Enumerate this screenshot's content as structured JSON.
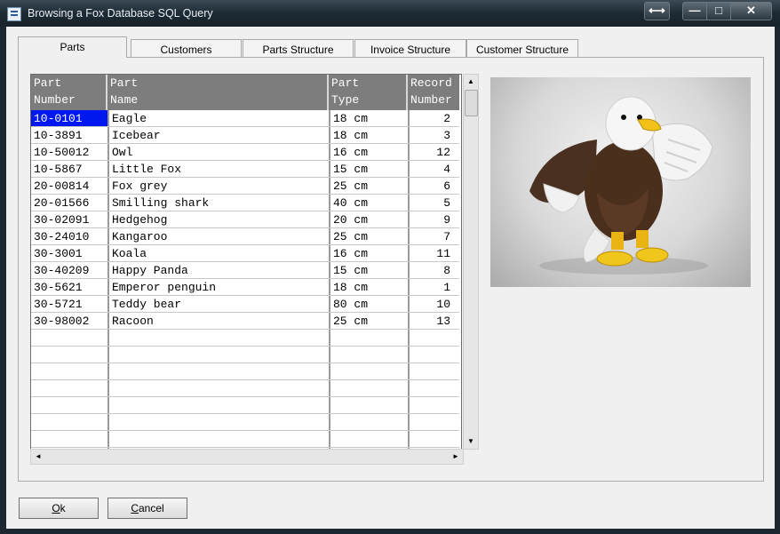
{
  "window": {
    "title": "Browsing a Fox Database SQL Query",
    "buttons": {
      "resize": "⟷",
      "minimize": "—",
      "maximize": "□",
      "close": "✕"
    }
  },
  "tabs": [
    {
      "label": "Parts",
      "active": true
    },
    {
      "label": "Customers",
      "active": false
    },
    {
      "label": "Parts Structure",
      "active": false
    },
    {
      "label": "Invoice Structure",
      "active": false
    },
    {
      "label": "Customer Structure",
      "active": false
    }
  ],
  "grid": {
    "columns": [
      {
        "line1": "Part",
        "line2": "Number"
      },
      {
        "line1": "Part",
        "line2": "Name"
      },
      {
        "line1": "Part",
        "line2": "Type"
      },
      {
        "line1": "Record",
        "line2": "Number"
      }
    ],
    "rows": [
      {
        "number": "10-0101",
        "name": "Eagle",
        "type": "18 cm",
        "record": "2",
        "selected": true
      },
      {
        "number": "10-3891",
        "name": "Icebear",
        "type": "18 cm",
        "record": "3"
      },
      {
        "number": "10-50012",
        "name": "Owl",
        "type": "16 cm",
        "record": "12"
      },
      {
        "number": "10-5867",
        "name": "Little Fox",
        "type": "15 cm",
        "record": "4"
      },
      {
        "number": "20-00814",
        "name": "Fox grey",
        "type": "25 cm",
        "record": "6"
      },
      {
        "number": "20-01566",
        "name": "Smilling shark",
        "type": "40 cm",
        "record": "5"
      },
      {
        "number": "30-02091",
        "name": "Hedgehog",
        "type": "20 cm",
        "record": "9"
      },
      {
        "number": "30-24010",
        "name": "Kangaroo",
        "type": "25 cm",
        "record": "7"
      },
      {
        "number": "30-3001",
        "name": "Koala",
        "type": "16 cm",
        "record": "11"
      },
      {
        "number": "30-40209",
        "name": "Happy Panda",
        "type": "15 cm",
        "record": "8"
      },
      {
        "number": "30-5621",
        "name": "Emperor penguin",
        "type": "18 cm",
        "record": "1"
      },
      {
        "number": "30-5721",
        "name": "Teddy bear",
        "type": "80 cm",
        "record": "10"
      },
      {
        "number": "30-98002",
        "name": "Racoon",
        "type": "25 cm",
        "record": "13"
      }
    ],
    "empty_rows": 7,
    "scroll": {
      "up": "▲",
      "down": "▼",
      "left": "◄",
      "right": "►"
    }
  },
  "image": {
    "subject": "plush eagle toy"
  },
  "buttons": {
    "ok": {
      "accel": "O",
      "rest": "k"
    },
    "cancel": {
      "accel": "C",
      "rest": "ancel"
    }
  },
  "colors": {
    "selection": "#0018f0",
    "header": "#7d7d7d"
  }
}
